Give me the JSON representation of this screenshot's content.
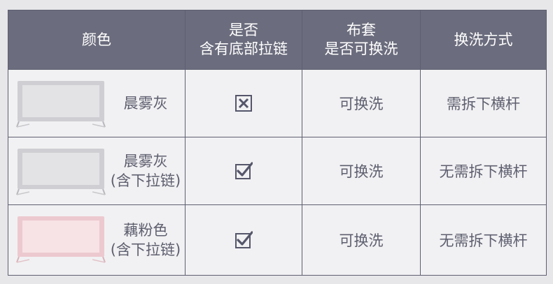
{
  "header": {
    "col1": [
      "颜色"
    ],
    "col2": [
      "是否",
      "含有底部拉链"
    ],
    "col3": [
      "布套",
      "是否可换洗"
    ],
    "col4": [
      "换洗方式"
    ]
  },
  "rows": [
    {
      "name": [
        "晨雾灰"
      ],
      "zipper_icon": "cross-box-icon",
      "washable": "可换洗",
      "method": "需拆下横杆",
      "swatch": "#d9d9dc",
      "frame": "#bfbfc4"
    },
    {
      "name": [
        "晨雾灰",
        "(含下拉链)"
      ],
      "zipper_icon": "check-box-icon",
      "washable": "可换洗",
      "method": "无需拆下横杆",
      "swatch": "#d9d9dc",
      "frame": "#bfbfc4"
    },
    {
      "name": [
        "藕粉色",
        "(含下拉链)"
      ],
      "zipper_icon": "check-box-icon",
      "washable": "可换洗",
      "method": "无需拆下横杆",
      "swatch": "#f3dcdf",
      "frame": "#e8c2c8"
    }
  ],
  "colors": {
    "header_bg": "#6b6c7d",
    "cell_bg": "#f1f1f3",
    "border": "#5e5f70",
    "text": "#5e5f6f"
  }
}
